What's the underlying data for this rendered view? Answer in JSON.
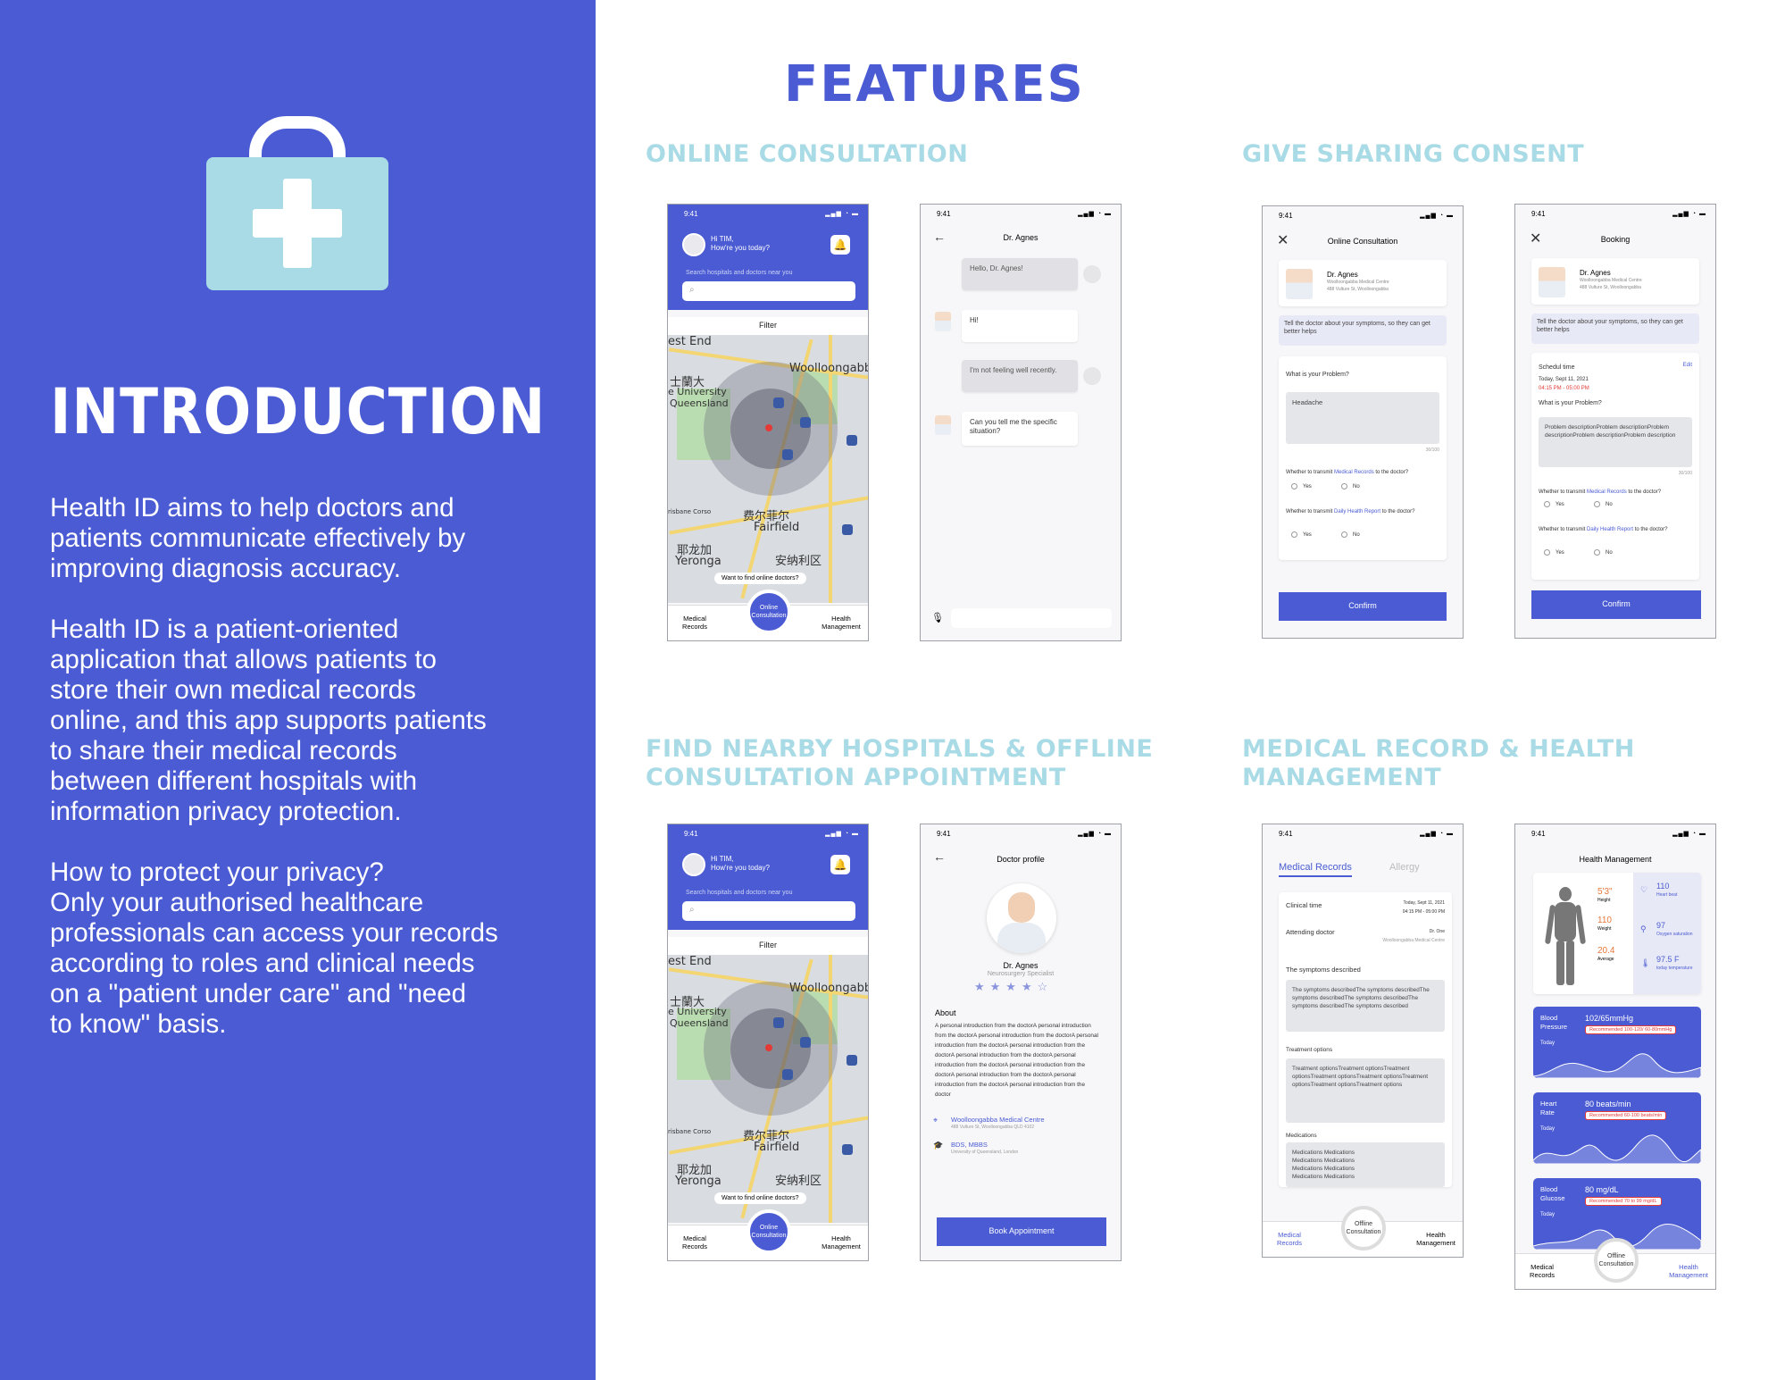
{
  "intro": {
    "title": "INTRODUCTION",
    "paragraph_1": "Health ID aims to help doctors and\npatients communicate effectively by\nimproving diagnosis accuracy.",
    "paragraph_2": "Health ID is a patient-oriented\napplication that allows patients to\nstore their own medical records\nonline, and this app supports patients\nto share their medical records\nbetween different hospitals with\ninformation privacy protection.",
    "paragraph_3": "How to protect your privacy?\nOnly  your authorised healthcare\nprofessionals can access your records\naccording to roles and clinical needs\non a \"patient under care\" and \"need\nto know\" basis."
  },
  "features": {
    "title": "FEATURES",
    "sections": {
      "online_consultation": "ONLINE CONSULTATION",
      "sharing_consent": "GIVE SHARING CONSENT",
      "nearby": "FIND NEARBY HOSPITALS & OFFLINE\nCONSULTATION APPOINTMENT",
      "medical_record": "MEDICAL RECORD & HEALTH MANAGEMENT"
    }
  },
  "status_time": "9:41",
  "home": {
    "greeting": "Hi TIM,",
    "sub": "How're you today?",
    "search_label": "Search hospitals and doctors near you",
    "filter": "Filter",
    "map_labels": [
      "est End",
      "Woolloongabb",
      "士蘭大",
      "e University",
      "Queensland",
      "费尔菲尔",
      "Fairfield",
      "耶龙加",
      "Yeronga",
      "安纳利区",
      "risbane Corso"
    ],
    "want_online": "Want to find online doctors?",
    "want_online_2": "Want to find online doctors?",
    "tab_left": "Medical\nRecords",
    "tab_mid": "Online\nConsultation",
    "tab_right": "Health\nManagement"
  },
  "chat": {
    "doctor": "Dr. Agnes",
    "msg1": "Hello, Dr. Agnes!",
    "msg2": "Hi!",
    "msg3": "I'm not feeling well recently.",
    "msg4": "Can you tell me the specific\nsituation?"
  },
  "consult": {
    "title": "Online Consultation",
    "doctor": "Dr. Agnes",
    "clinic": "Woolloongabba Medical Centre",
    "address": "488 Vulture St, Woolloongabba",
    "note": "Tell the doctor about your symptoms, so they can get better helps",
    "question": "What is your Problem?",
    "answer": "Headache",
    "counter": "30/100",
    "q_records_pre": "Whether to transmit ",
    "q_records_link": "Medical Records",
    "q_records_post": " to the doctor?",
    "q_report_pre": "Whether to transmit ",
    "q_report_link": "Daily Health Report",
    "q_report_post": " to the doctor?",
    "yes": "Yes",
    "no": "No",
    "confirm": "Confirm"
  },
  "booking": {
    "title": "Booking",
    "doctor": "Dr. Agnes",
    "clinic": "Woolloongabba Medical Centre",
    "address": "488 Vulture St, Woolloongabba",
    "note": "Tell the doctor about your symptoms, so they can get better helps",
    "schedule": "Schedul time",
    "edit": "Edit",
    "date": "Today, Sept 11, 2021",
    "time": "04:15 PM - 05:00 PM",
    "question": "What is your Problem?",
    "answer": "Problem descriptionProblem descriptionProblem descriptionProblem descriptionProblem description",
    "counter": "30/100",
    "confirm": "Confirm"
  },
  "profile": {
    "title": "Doctor profile",
    "name": "Dr. Agnes",
    "role": "Neurosurgery Specialist",
    "about": "About",
    "about_text": "A personal introduction from the doctorA personal introduction from the doctorA personal introduction from the doctorA personal introduction from the doctorA personal introduction from the doctorA personal introduction from the doctorA personal introduction from the doctorA personal introduction from the doctorA personal introduction from the doctorA personal introduction from the doctorA personal introduction from the doctor",
    "clinic": "Woolloongabba Medical Centre",
    "address": "488 Vulture St, Woolloongabba QLD 4102",
    "degree": "BDS, MBBS",
    "uni": "University of Queensland, London",
    "book": "Book Appointment",
    "rating": 4.5
  },
  "records": {
    "tab_records": "Medical Records",
    "tab_allergy": "Allergy",
    "clinical_time": "Clinical time",
    "clinical_date": "Today, Sept 11, 2021",
    "clinical_hours": "04:15 PM - 05:00 PM",
    "attending": "Attending doctor",
    "attending_name": "Dr. One",
    "attending_clinic": "Woolloongabba Medical Centre",
    "symptoms_label": "The symptoms described",
    "symptoms": "The symptoms describedThe symptoms describedThe symptoms describedThe symptoms describedThe symptoms describedThe symptoms described",
    "treatment_label": "Treatment options",
    "treatment": "Treatment optionsTreatment optionsTreatment optionsTreatment optionsTreatment optionsTreatment optionsTreatment optionsTreatment options",
    "medications_label": "Medications",
    "medications": "Medications Medications\nMedications Medications\nMedications Medications\nMedications Medications",
    "tab_left": "Medical\nRecords",
    "tab_mid": "Offline\nConsultation",
    "tab_right": "Health\nManagement"
  },
  "health": {
    "title": "Health Management",
    "height_label": "Height",
    "height": "5'3\"",
    "weight_label": "Weight",
    "weight": "110",
    "bmi_label": "Average",
    "bmi": "20.4",
    "heart_beat": "110",
    "heart_beat_label": "Heart beat",
    "oxygen": "97",
    "oxygen_label": "Oxygen saturation",
    "temp": "97.5 F",
    "temp_label": "today temperature",
    "bp_label": "Blood\nPressure",
    "bp_value": "102/65mmHg",
    "bp_rec": "Recommended 100-120/ 60-80mmHg",
    "hr_label": "Heart\nRate",
    "hr_value": "80 beats/min",
    "hr_rec": "Recommended 60-100 beats/min",
    "bg_label": "Blood\nGlucose",
    "bg_value": "80 mg/dL",
    "bg_rec": "Recommended 70 to 99 mg/dL",
    "today": "Today",
    "tab_left": "Medical\nRecords",
    "tab_mid": "Offline\nConsultation",
    "tab_right": "Health\nManagement"
  },
  "colors": {
    "brand": "#4a5bd3",
    "accent_light": "#a9dbe6",
    "alert": "#e53935"
  }
}
